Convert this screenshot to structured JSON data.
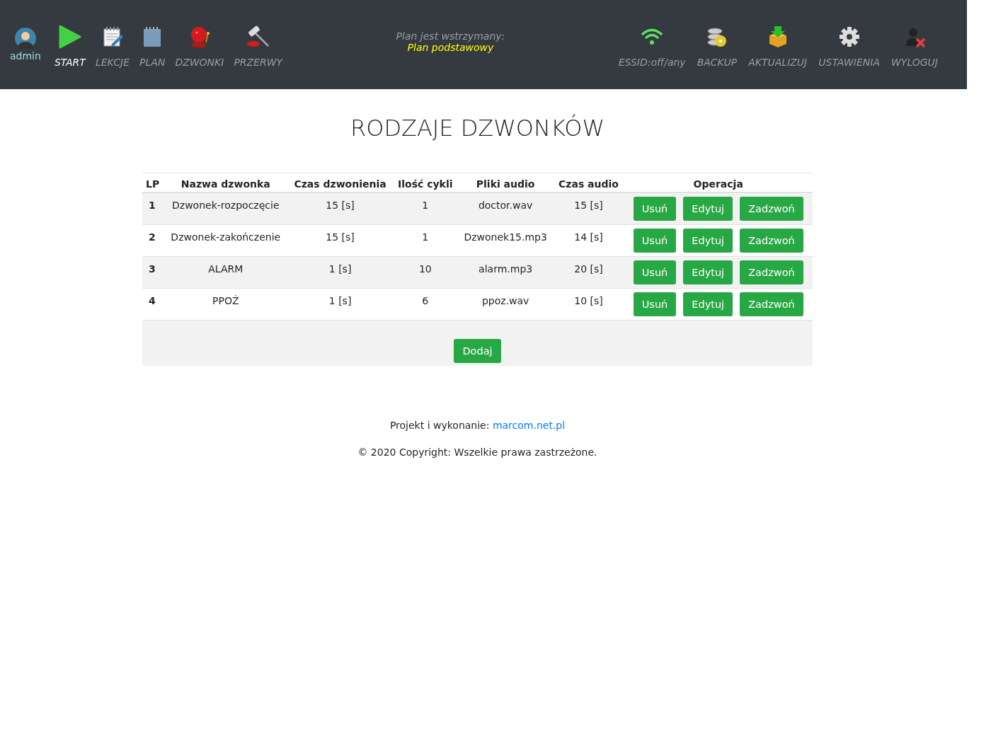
{
  "user": {
    "name": "admin"
  },
  "nav_left": [
    {
      "kind": "play",
      "label": "START",
      "selected": true
    },
    {
      "kind": "notepad",
      "label": "LEKCJE",
      "selected": false
    },
    {
      "kind": "notebook",
      "label": "PLAN",
      "selected": false
    },
    {
      "kind": "bell",
      "label": "DZWONKI",
      "selected": false
    },
    {
      "kind": "hammer",
      "label": "PRZERWY",
      "selected": false
    }
  ],
  "plan_status": {
    "label": "Plan jest wstrzymany:",
    "plan": "Plan podstawowy"
  },
  "nav_right": [
    {
      "kind": "wifi",
      "label": "ESSID:off/any"
    },
    {
      "kind": "database",
      "label": "BACKUP"
    },
    {
      "kind": "box",
      "label": "AKTUALIZUJ"
    },
    {
      "kind": "gear",
      "label": "USTAWIENIA"
    },
    {
      "kind": "logout",
      "label": "WYLOGUJ"
    }
  ],
  "title": "RODZAJE DZWONKÓW",
  "table": {
    "columns": [
      "LP",
      "Nazwa dzwonka",
      "Czas dzwonienia",
      "Ilość cykli",
      "Pliki audio",
      "Czas audio",
      "Operacja"
    ],
    "rows": [
      {
        "cells": [
          "1",
          "Dzwonek-rozpoczęcie",
          "15 [s]",
          "1",
          "doctor.wav",
          "15 [s]"
        ],
        "actions": [
          "Usuń",
          "Edytuj",
          "Zadzwoń"
        ]
      },
      {
        "cells": [
          "2",
          "Dzwonek-zakończenie",
          "15 [s]",
          "1",
          "Dzwonek15.mp3",
          "14 [s]"
        ],
        "actions": [
          "Usuń",
          "Edytuj",
          "Zadzwoń"
        ]
      },
      {
        "cells": [
          "3",
          "ALARM",
          "1 [s]",
          "10",
          "alarm.mp3",
          "20 [s]"
        ],
        "actions": [
          "Usuń",
          "Edytuj",
          "Zadzwoń"
        ]
      },
      {
        "cells": [
          "4",
          "PPOŻ",
          "1 [s]",
          "6",
          "ppoz.wav",
          "10 [s]"
        ],
        "actions": [
          "Usuń",
          "Edytuj",
          "Zadzwoń"
        ]
      }
    ],
    "add_button": "Dodaj"
  },
  "footer": {
    "credit": "Projekt i wykonanie:",
    "link": "marcom.net.pl",
    "copyright": "© 2020 Copyright: Wszelkie prawa zastrzeżone."
  }
}
